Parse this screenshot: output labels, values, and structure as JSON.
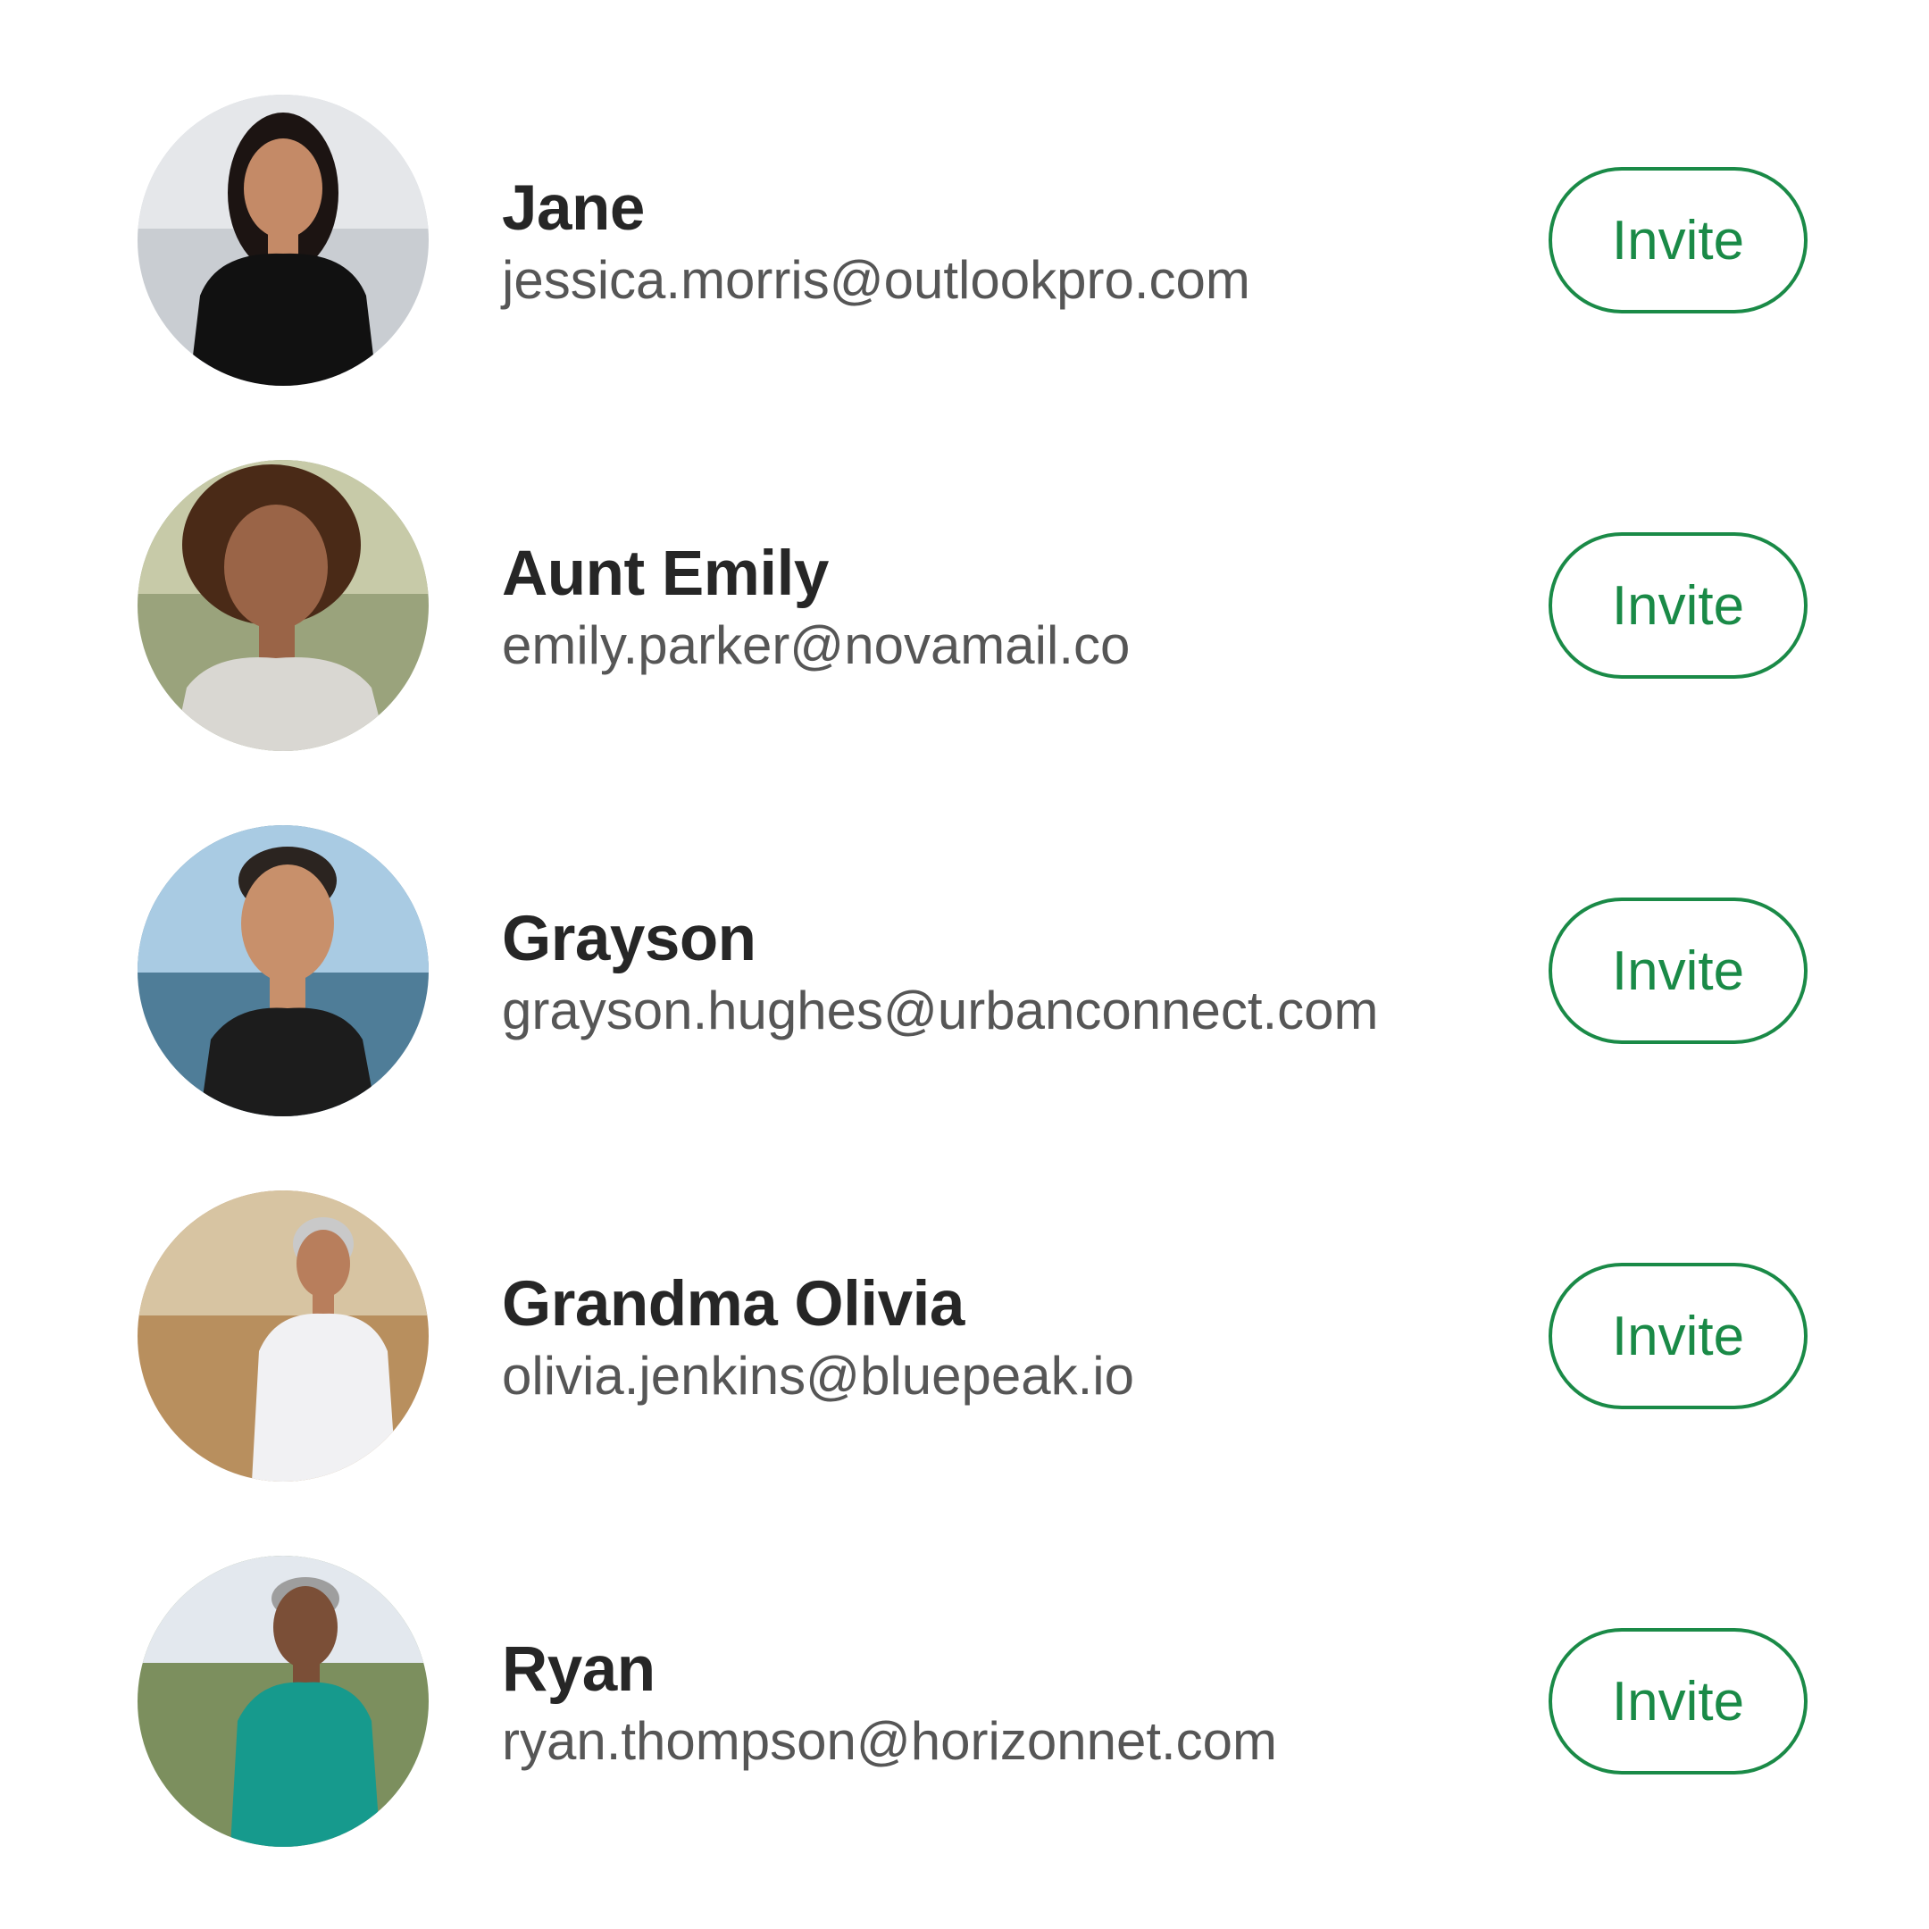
{
  "contacts": [
    {
      "name": "Jane",
      "email": "jessica.morris@outlookpro.com",
      "invite_label": "Invite",
      "avatar": {
        "background": "#c9cdd2",
        "sky": "#e5e7ea",
        "skin": "#c48a67",
        "hair": "#1c1412",
        "shirt": "#111111"
      }
    },
    {
      "name": "Aunt Emily",
      "email": "emily.parker@novamail.co",
      "invite_label": "Invite",
      "avatar": {
        "background": "#9aa37c",
        "sky": "#c7caa8",
        "skin": "#9a6447",
        "hair": "#4a2a17",
        "shirt": "#d9d7d2"
      }
    },
    {
      "name": "Grayson",
      "email": "grayson.hughes@urbanconnect.com",
      "invite_label": "Invite",
      "avatar": {
        "background": "#4f7d98",
        "sky": "#a9cbe3",
        "skin": "#c8906b",
        "hair": "#2b2420",
        "shirt": "#1c1c1c"
      }
    },
    {
      "name": "Grandma Olivia",
      "email": "olivia.jenkins@bluepeak.io",
      "invite_label": "Invite",
      "avatar": {
        "background": "#b88f5e",
        "sky": "#d7c4a2",
        "skin": "#b87e5c",
        "hair": "#c9c9c9",
        "shirt": "#f1f1f3"
      }
    },
    {
      "name": "Ryan",
      "email": "ryan.thompson@horizonnet.com",
      "invite_label": "Invite",
      "avatar": {
        "background": "#7c8f5e",
        "sky": "#e3e8ee",
        "skin": "#7b4f37",
        "hair": "#9e9e9e",
        "shirt": "#169a8d"
      }
    }
  ],
  "colors": {
    "accent": "#1a8a47",
    "name_text": "#262626",
    "email_text": "#565656",
    "background": "#ffffff"
  }
}
